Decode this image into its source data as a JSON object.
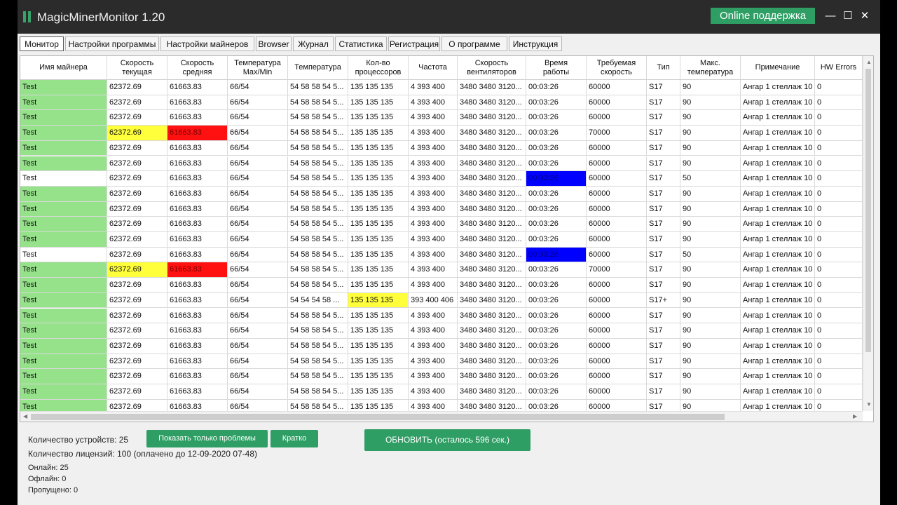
{
  "window": {
    "title": "MagicMinerMonitor 1.20",
    "support_button": "Online поддержка",
    "controls": {
      "minimize": "—",
      "maximize": "☐",
      "close": "✕"
    }
  },
  "tabs": [
    {
      "label": "Монитор",
      "active": true
    },
    {
      "label": "Настройки программы"
    },
    {
      "label": "Настройки майнеров"
    },
    {
      "label": "Browser"
    },
    {
      "label": "Журнал"
    },
    {
      "label": "Статистика"
    },
    {
      "label": "Регистрация"
    },
    {
      "label": "О программе"
    },
    {
      "label": "Инструкция"
    }
  ],
  "columns": [
    "Имя майнера",
    "Скорость\nтекущая",
    "Скорость\nсредняя",
    "Температура\nMax/Min",
    "Температура",
    "Кол-во\nпроцессоров",
    "Частота",
    "Скорость\nвентиляторов",
    "Время\nработы",
    "Требуемая\nскорость",
    "Тип",
    "Макс.\nтемпература",
    "Примечание",
    "HW Errors"
  ],
  "colors": {
    "online": "#95e28a",
    "warn": "#ffff3c",
    "error": "#ff1111",
    "offline_time": "#0000ff",
    "accent_button": "#2e9e64"
  },
  "rows": [
    {
      "status": "online",
      "cells": [
        "Test",
        "62372.69",
        "61663.83",
        "66/54",
        "54 58 58 54 5...",
        "135 135 135",
        "4 393 400",
        "3480 3480 3120...",
        "00:03:26",
        "60000",
        "S17",
        "90",
        "Ангар 1 стеллаж 10",
        "0"
      ]
    },
    {
      "status": "online",
      "cells": [
        "Test",
        "62372.69",
        "61663.83",
        "66/54",
        "54 58 58 54 5...",
        "135 135 135",
        "4 393 400",
        "3480 3480 3120...",
        "00:03:26",
        "60000",
        "S17",
        "90",
        "Ангар 1 стеллаж 10",
        "0"
      ]
    },
    {
      "status": "online",
      "cells": [
        "Test",
        "62372.69",
        "61663.83",
        "66/54",
        "54 58 58 54 5...",
        "135 135 135",
        "4 393 400",
        "3480 3480 3120...",
        "00:03:26",
        "60000",
        "S17",
        "90",
        "Ангар 1 стеллаж 10",
        "0"
      ]
    },
    {
      "status": "online",
      "highlights": {
        "1": "warn",
        "2": "error"
      },
      "cells": [
        "Test",
        "62372.69",
        "61663.83",
        "66/54",
        "54 58 58 54 5...",
        "135 135 135",
        "4 393 400",
        "3480 3480 3120...",
        "00:03:26",
        "70000",
        "S17",
        "90",
        "Ангар 1 стеллаж 10",
        "0"
      ]
    },
    {
      "status": "online",
      "cells": [
        "Test",
        "62372.69",
        "61663.83",
        "66/54",
        "54 58 58 54 5...",
        "135 135 135",
        "4 393 400",
        "3480 3480 3120...",
        "00:03:26",
        "60000",
        "S17",
        "90",
        "Ангар 1 стеллаж 10",
        "0"
      ]
    },
    {
      "status": "online",
      "cells": [
        "Test",
        "62372.69",
        "61663.83",
        "66/54",
        "54 58 58 54 5...",
        "135 135 135",
        "4 393 400",
        "3480 3480 3120...",
        "00:03:26",
        "60000",
        "S17",
        "90",
        "Ангар 1 стеллаж 10",
        "0"
      ]
    },
    {
      "status": "none",
      "highlights": {
        "8": "offline_time"
      },
      "cells": [
        "Test",
        "62372.69",
        "61663.83",
        "66/54",
        "54 58 58 54 5...",
        "135 135 135",
        "4 393 400",
        "3480 3480 3120...",
        "00:03:26",
        "60000",
        "S17",
        "50",
        "Ангар 1 стеллаж 10",
        "0"
      ]
    },
    {
      "status": "online",
      "cells": [
        "Test",
        "62372.69",
        "61663.83",
        "66/54",
        "54 58 58 54 5...",
        "135 135 135",
        "4 393 400",
        "3480 3480 3120...",
        "00:03:26",
        "60000",
        "S17",
        "90",
        "Ангар 1 стеллаж 10",
        "0"
      ]
    },
    {
      "status": "online",
      "cells": [
        "Test",
        "62372.69",
        "61663.83",
        "66/54",
        "54 58 58 54 5...",
        "135 135 135",
        "4 393 400",
        "3480 3480 3120...",
        "00:03:26",
        "60000",
        "S17",
        "90",
        "Ангар 1 стеллаж 10",
        "0"
      ]
    },
    {
      "status": "online",
      "cells": [
        "Test",
        "62372.69",
        "61663.83",
        "66/54",
        "54 58 58 54 5...",
        "135 135 135",
        "4 393 400",
        "3480 3480 3120...",
        "00:03:26",
        "60000",
        "S17",
        "90",
        "Ангар 1 стеллаж 10",
        "0"
      ]
    },
    {
      "status": "online",
      "cells": [
        "Test",
        "62372.69",
        "61663.83",
        "66/54",
        "54 58 58 54 5...",
        "135 135 135",
        "4 393 400",
        "3480 3480 3120...",
        "00:03:26",
        "60000",
        "S17",
        "90",
        "Ангар 1 стеллаж 10",
        "0"
      ]
    },
    {
      "status": "none",
      "highlights": {
        "8": "offline_time"
      },
      "cells": [
        "Test",
        "62372.69",
        "61663.83",
        "66/54",
        "54 58 58 54 5...",
        "135 135 135",
        "4 393 400",
        "3480 3480 3120...",
        "00:03:26",
        "60000",
        "S17",
        "50",
        "Ангар 1 стеллаж 10",
        "0"
      ]
    },
    {
      "status": "online",
      "highlights": {
        "1": "warn",
        "2": "error"
      },
      "cells": [
        "Test",
        "62372.69",
        "61663.83",
        "66/54",
        "54 58 58 54 5...",
        "135 135 135",
        "4 393 400",
        "3480 3480 3120...",
        "00:03:26",
        "70000",
        "S17",
        "90",
        "Ангар 1 стеллаж 10",
        "0"
      ]
    },
    {
      "status": "online",
      "cells": [
        "Test",
        "62372.69",
        "61663.83",
        "66/54",
        "54 58 58 54 5...",
        "135 135 135",
        "4 393 400",
        "3480 3480 3120...",
        "00:03:26",
        "60000",
        "S17",
        "90",
        "Ангар 1 стеллаж 10",
        "0"
      ]
    },
    {
      "status": "online",
      "highlights": {
        "5": "warn"
      },
      "cells": [
        "Test",
        "62372.69",
        "61663.83",
        "66/54",
        "54 54 54 58 ...",
        "135 135 135",
        "393 400 406",
        "3480 3480 3120...",
        "00:03:26",
        "60000",
        "S17+",
        "90",
        "Ангар 1 стеллаж 10",
        "0"
      ]
    },
    {
      "status": "online",
      "cells": [
        "Test",
        "62372.69",
        "61663.83",
        "66/54",
        "54 58 58 54 5...",
        "135 135 135",
        "4 393 400",
        "3480 3480 3120...",
        "00:03:26",
        "60000",
        "S17",
        "90",
        "Ангар 1 стеллаж 10",
        "0"
      ]
    },
    {
      "status": "online",
      "cells": [
        "Test",
        "62372.69",
        "61663.83",
        "66/54",
        "54 58 58 54 5...",
        "135 135 135",
        "4 393 400",
        "3480 3480 3120...",
        "00:03:26",
        "60000",
        "S17",
        "90",
        "Ангар 1 стеллаж 10",
        "0"
      ]
    },
    {
      "status": "online",
      "cells": [
        "Test",
        "62372.69",
        "61663.83",
        "66/54",
        "54 58 58 54 5...",
        "135 135 135",
        "4 393 400",
        "3480 3480 3120...",
        "00:03:26",
        "60000",
        "S17",
        "90",
        "Ангар 1 стеллаж 10",
        "0"
      ]
    },
    {
      "status": "online",
      "cells": [
        "Test",
        "62372.69",
        "61663.83",
        "66/54",
        "54 58 58 54 5...",
        "135 135 135",
        "4 393 400",
        "3480 3480 3120...",
        "00:03:26",
        "60000",
        "S17",
        "90",
        "Ангар 1 стеллаж 10",
        "0"
      ]
    },
    {
      "status": "online",
      "cells": [
        "Test",
        "62372.69",
        "61663.83",
        "66/54",
        "54 58 58 54 5...",
        "135 135 135",
        "4 393 400",
        "3480 3480 3120...",
        "00:03:26",
        "60000",
        "S17",
        "90",
        "Ангар 1 стеллаж 10",
        "0"
      ]
    },
    {
      "status": "online",
      "cells": [
        "Test",
        "62372.69",
        "61663.83",
        "66/54",
        "54 58 58 54 5...",
        "135 135 135",
        "4 393 400",
        "3480 3480 3120...",
        "00:03:26",
        "60000",
        "S17",
        "90",
        "Ангар 1 стеллаж 10",
        "0"
      ]
    },
    {
      "status": "online",
      "cells": [
        "Test",
        "62372.69",
        "61663.83",
        "66/54",
        "54 58 58 54 5...",
        "135 135 135",
        "4 393 400",
        "3480 3480 3120...",
        "00:03:26",
        "60000",
        "S17",
        "90",
        "Ангар 1 стеллаж 10",
        "0"
      ]
    }
  ],
  "footer": {
    "device_count": "Количество устройств: 25",
    "license_count": "Количество лицензий: 100 (оплачено до 12-09-2020 07-48)",
    "online": "Онлайн: 25",
    "offline": "Офлайн: 0",
    "skipped": "Пропущено: 0",
    "show_problems_button": "Показать только проблемы",
    "brief_button": "Кратко",
    "refresh_button": "ОБНОВИТЬ (осталось 596 сек.)"
  }
}
